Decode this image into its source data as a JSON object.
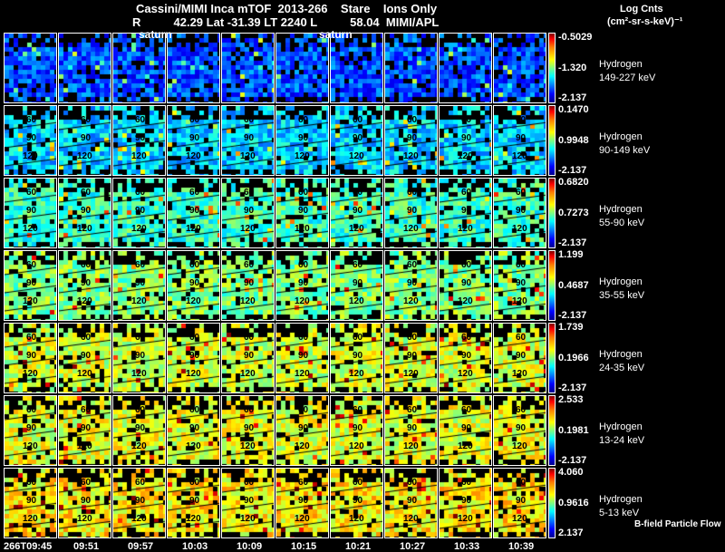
{
  "header": {
    "title": "Cassini/MIMI Inca mTOF  2013-266    Stare    Ions Only",
    "subtitle": "R          42.29 Lat -31.39 LT 2240 L          58.04  MIMI/APL",
    "saturn_label": "saturn",
    "units_line1": "Log Cnts",
    "units_line2": "(cm²-sr-s-keV)⁻¹"
  },
  "chart_data": {
    "type": "heatmap",
    "title": "Cassini/MIMI Inca mTOF 2013-266 Stare Ions Only",
    "x_ticks": [
      "266T09:45",
      "09:51",
      "09:57",
      "10:03",
      "10:09",
      "10:15",
      "10:21",
      "10:27",
      "10:33",
      "10:39"
    ],
    "contour_labels": [
      "60",
      "90",
      "120"
    ],
    "rows": [
      {
        "species": "Hydrogen",
        "energy": "149-227 keV",
        "max": "-0.5029",
        "mid": "-1.320",
        "min": "-2.137",
        "level": 0.2,
        "contours": false
      },
      {
        "species": "Hydrogen",
        "energy": "90-149 keV",
        "max": "0.1470",
        "mid": "0.9948",
        "min": "-2.137",
        "level": 0.33,
        "contours": true
      },
      {
        "species": "Hydrogen",
        "energy": "55-90 keV",
        "max": "0.6820",
        "mid": "0.7273",
        "min": "-2.137",
        "level": 0.43,
        "contours": true
      },
      {
        "species": "Hydrogen",
        "energy": "35-55 keV",
        "max": "1.199",
        "mid": "0.4687",
        "min": "-2.137",
        "level": 0.5,
        "contours": true
      },
      {
        "species": "Hydrogen",
        "energy": "24-35 keV",
        "max": "1.739",
        "mid": "0.1966",
        "min": "-2.137",
        "level": 0.58,
        "contours": true
      },
      {
        "species": "Hydrogen",
        "energy": "13-24 keV",
        "max": "2.533",
        "mid": "0.1981",
        "min": "-2.137",
        "level": 0.6,
        "contours": true
      },
      {
        "species": "Hydrogen",
        "energy": "5-13 keV",
        "max": "4.060",
        "mid": "0.9616",
        "min": "2.137",
        "level": 0.64,
        "contours": true
      }
    ],
    "footer_label": "B-field Particle Flow"
  }
}
